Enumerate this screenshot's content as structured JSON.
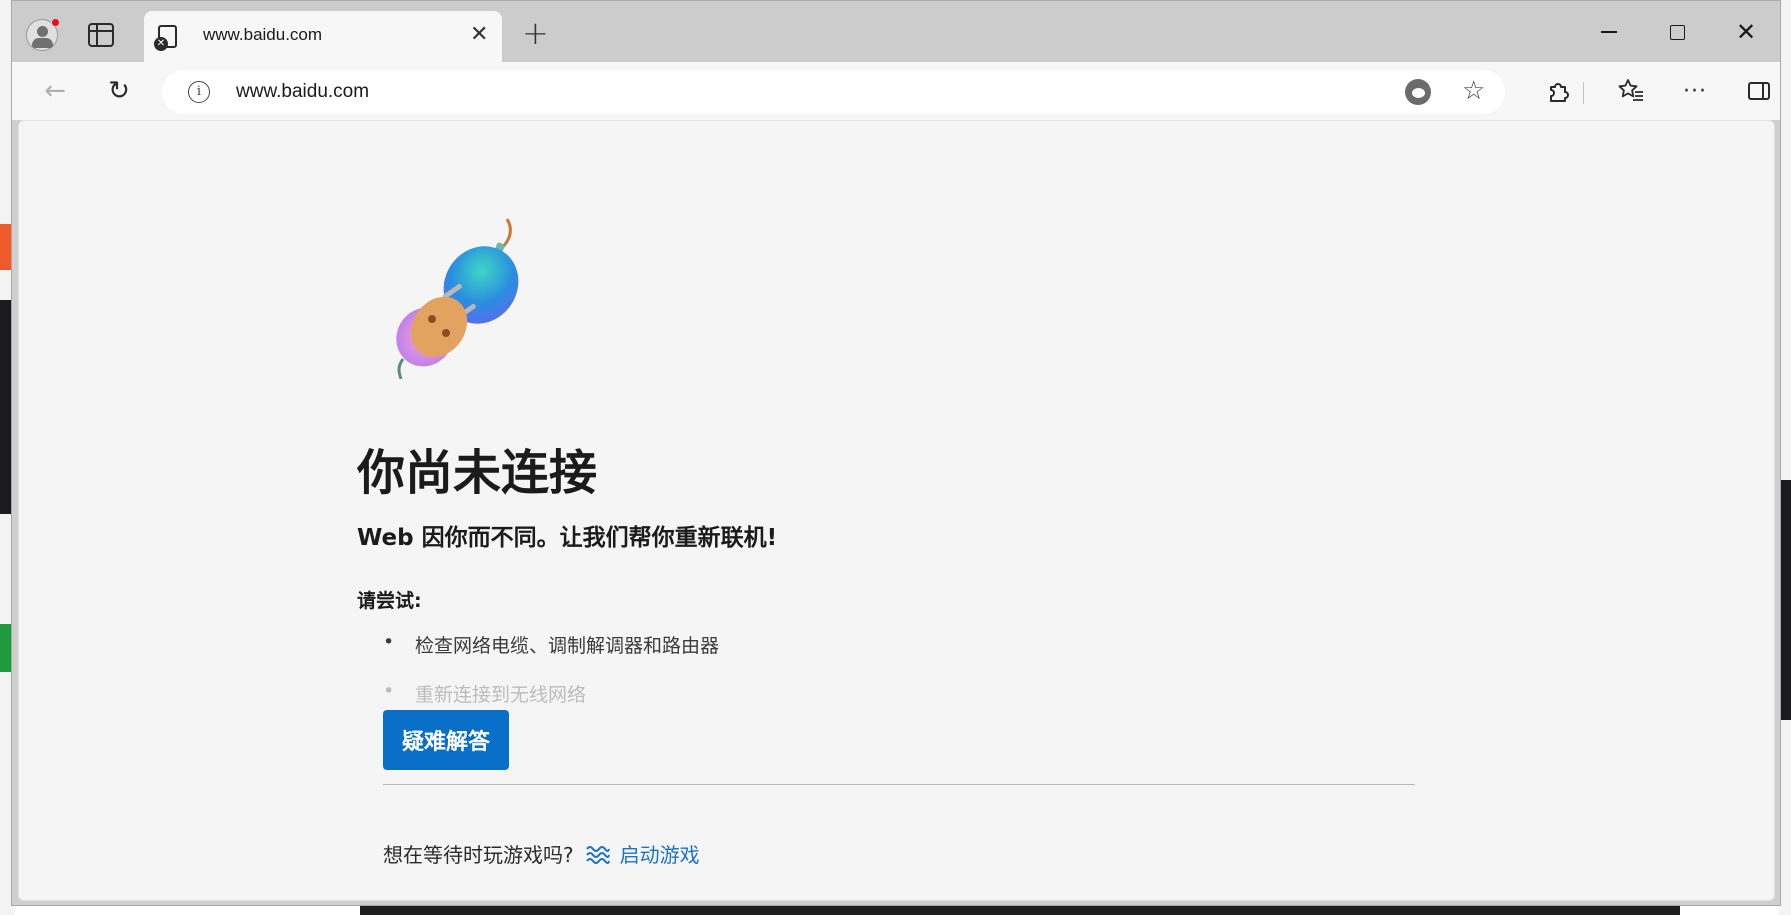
{
  "browser": {
    "tab": {
      "title": "www.baidu.com",
      "close_icon": "close-icon"
    },
    "new_tab_icon": "plus-icon",
    "window_controls": [
      "minimize-icon",
      "maximize-icon",
      "close-icon"
    ],
    "address_bar": {
      "url": "www.baidu.com",
      "info_glyph": "i"
    },
    "toolbar_icons": [
      "back-icon",
      "refresh-icon",
      "edge-icon",
      "star-icon",
      "extensions-icon",
      "favorites-icon",
      "more-icon",
      "sidebar-icon"
    ]
  },
  "error_page": {
    "heading": "你尚未连接",
    "subheading": "Web 因你而不同。让我们帮你重新联机!",
    "try_label": "请尝试:",
    "suggestions": [
      "检查网络电缆、调制解调器和路由器",
      "重新连接到无线网络"
    ],
    "troubleshoot_button": "疑难解答",
    "game_prompt": "想在等待时玩游戏吗?",
    "game_link": "启动游戏"
  },
  "colors": {
    "accent": "#0a6fc9",
    "link": "#1a73c8",
    "titlebar": "#cccccc",
    "page_bg": "#f5f5f5"
  }
}
